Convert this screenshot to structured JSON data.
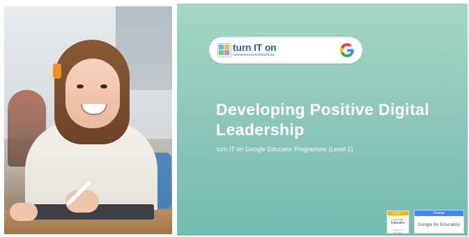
{
  "photo": {
    "icon": "classroom-photo"
  },
  "brand": {
    "name": "turn IT on",
    "logo_icon": "turnitOn-logo",
    "google_icon": "google-g-icon"
  },
  "slide": {
    "title_line1": "Developing Positive Digital",
    "title_line2": "Leadership",
    "subtitle": "turn IT on Google Educator Programme (Level 1)"
  },
  "badges": {
    "educator": {
      "level": "LEVEL 1",
      "certified": "CERTIFIED",
      "role": "Educator",
      "footer": "Google for Education"
    },
    "partner": {
      "label": "Partner",
      "name": "Google for Education"
    }
  },
  "colors": {
    "slide_top": "#a5d6c3",
    "slide_bottom": "#74bbb0",
    "brand_blue": "#1e66a8",
    "google_blue": "#4285f4",
    "google_red": "#ea4335",
    "google_yellow": "#fbbc05",
    "google_green": "#34a853",
    "level_yellow": "#f4b400"
  }
}
